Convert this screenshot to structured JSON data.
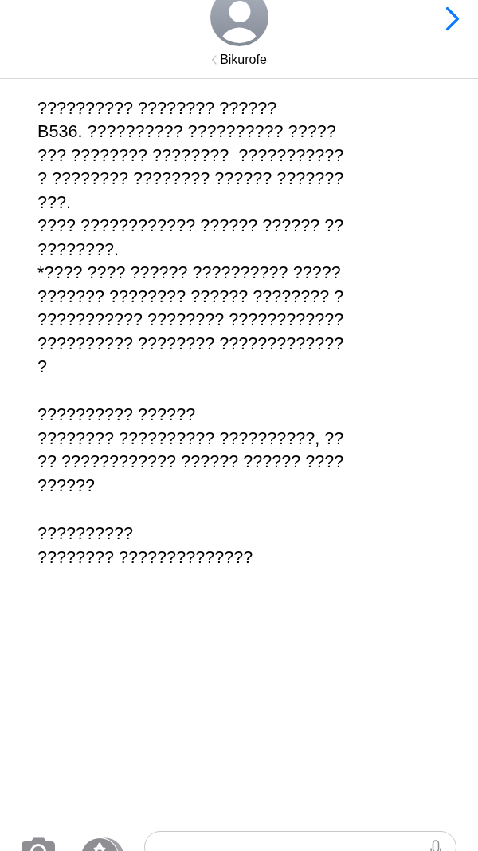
{
  "header": {
    "contact_name": "Bikurofe"
  },
  "message": {
    "paragraphs": [
      {
        "lines": [
          "?????????? ???????? ??????",
          "B536. ?????????? ?????????? ?????",
          "??? ???????? ????????  ???????????",
          "? ???????? ???????? ?????? ???????",
          "???.",
          "???? ???????????? ?????? ?????? ??",
          "????????.",
          "*???? ???? ?????? ?????????? ?????",
          "??????? ???????? ?????? ???????? ?",
          "??????????? ???????? ????????????",
          "?????????? ???????? ?????????????",
          "?"
        ]
      },
      {
        "lines": [
          "?????????? ??????",
          "???????? ?????????? ??????????, ??",
          "?? ???????????? ?????? ?????? ????",
          "??????"
        ]
      },
      {
        "lines": [
          "??????????",
          "???????? ??????????????"
        ]
      }
    ]
  }
}
